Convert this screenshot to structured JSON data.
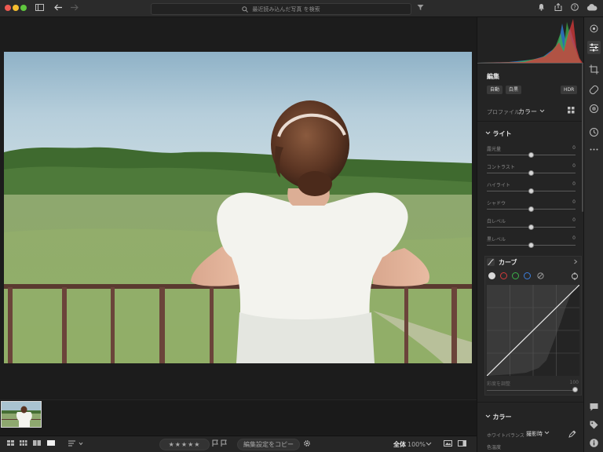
{
  "search": {
    "placeholder": "最近読み込んだ写真 を検索"
  },
  "panel": {
    "title": "編集",
    "buttons": {
      "auto": "自動",
      "bw": "白黒",
      "hdr": "HDR"
    },
    "profile": {
      "label": "プロファイル",
      "value": "カラー"
    },
    "light": {
      "title": "ライト",
      "sliders": [
        {
          "label": "露光量",
          "value": "0",
          "position": 0.5
        },
        {
          "label": "コントラスト",
          "value": "0",
          "position": 0.5
        },
        {
          "label": "ハイライト",
          "value": "0",
          "position": 0.5
        },
        {
          "label": "シャドウ",
          "value": "0",
          "position": 0.5
        },
        {
          "label": "白レベル",
          "value": "0",
          "position": 0.5
        },
        {
          "label": "黒レベル",
          "value": "0",
          "position": 0.5
        }
      ]
    },
    "curve": {
      "title": "カーブ",
      "channel_colors": [
        "#d8d8d8",
        "#d23b3b",
        "#3db04a",
        "#3b7ddb"
      ],
      "refine_label": "彩度を調整",
      "refine_value": "100",
      "refine_position": 1.0
    },
    "color": {
      "title": "カラー",
      "wb_label": "ホワイトバランス",
      "wb_value": "撮影時",
      "temp_label": "色温度"
    }
  },
  "bottom": {
    "copy_settings": "編集設定をコピー",
    "zoom_fit": "全体",
    "zoom_percent": "100%",
    "stars": "★★★★★"
  }
}
